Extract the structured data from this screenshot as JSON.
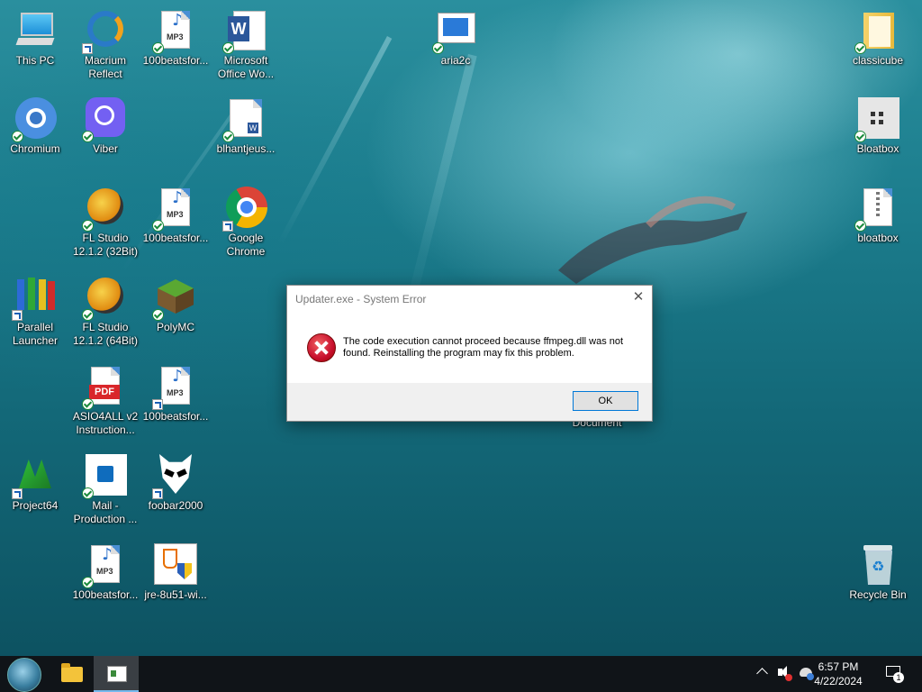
{
  "desktop": {
    "icons": [
      {
        "label": "This PC"
      },
      {
        "label": "Macrium Reflect"
      },
      {
        "label": "100beatsfor..."
      },
      {
        "label": "Microsoft Office Wo..."
      },
      {
        "label": "aria2c"
      },
      {
        "label": "classicube"
      },
      {
        "label": "Chromium"
      },
      {
        "label": "Viber"
      },
      {
        "label": "blhantjeus..."
      },
      {
        "label": "Bloatbox"
      },
      {
        "label": "FL Studio 12.1.2 (32Bit)"
      },
      {
        "label": "100beatsfor..."
      },
      {
        "label": "Google Chrome"
      },
      {
        "label": "bloatbox"
      },
      {
        "label": "Parallel Launcher"
      },
      {
        "label": "FL Studio 12.1.2 (64Bit)"
      },
      {
        "label": "PolyMC"
      },
      {
        "label": "ASIO4ALL v2 Instruction..."
      },
      {
        "label": "100beatsfor..."
      },
      {
        "label": "Document"
      },
      {
        "label": "Project64"
      },
      {
        "label": "Mail - Production ..."
      },
      {
        "label": "foobar2000"
      },
      {
        "label": "100beatsfor..."
      },
      {
        "label": "jre-8u51-wi..."
      },
      {
        "label": "Recycle Bin"
      }
    ],
    "icon_texts": {
      "mp3": "MP3",
      "pdf": "PDF",
      "word": "W"
    }
  },
  "dialog": {
    "title": "Updater.exe - System Error",
    "close_glyph": "✕",
    "message": "The code execution cannot proceed because ffmpeg.dll was not found. Reinstalling the program may fix this problem.",
    "ok_label": "OK"
  },
  "taskbar": {
    "time": "6:57 PM",
    "date": "4/22/2024",
    "notification_count": "1",
    "tray_chevron": "^"
  }
}
